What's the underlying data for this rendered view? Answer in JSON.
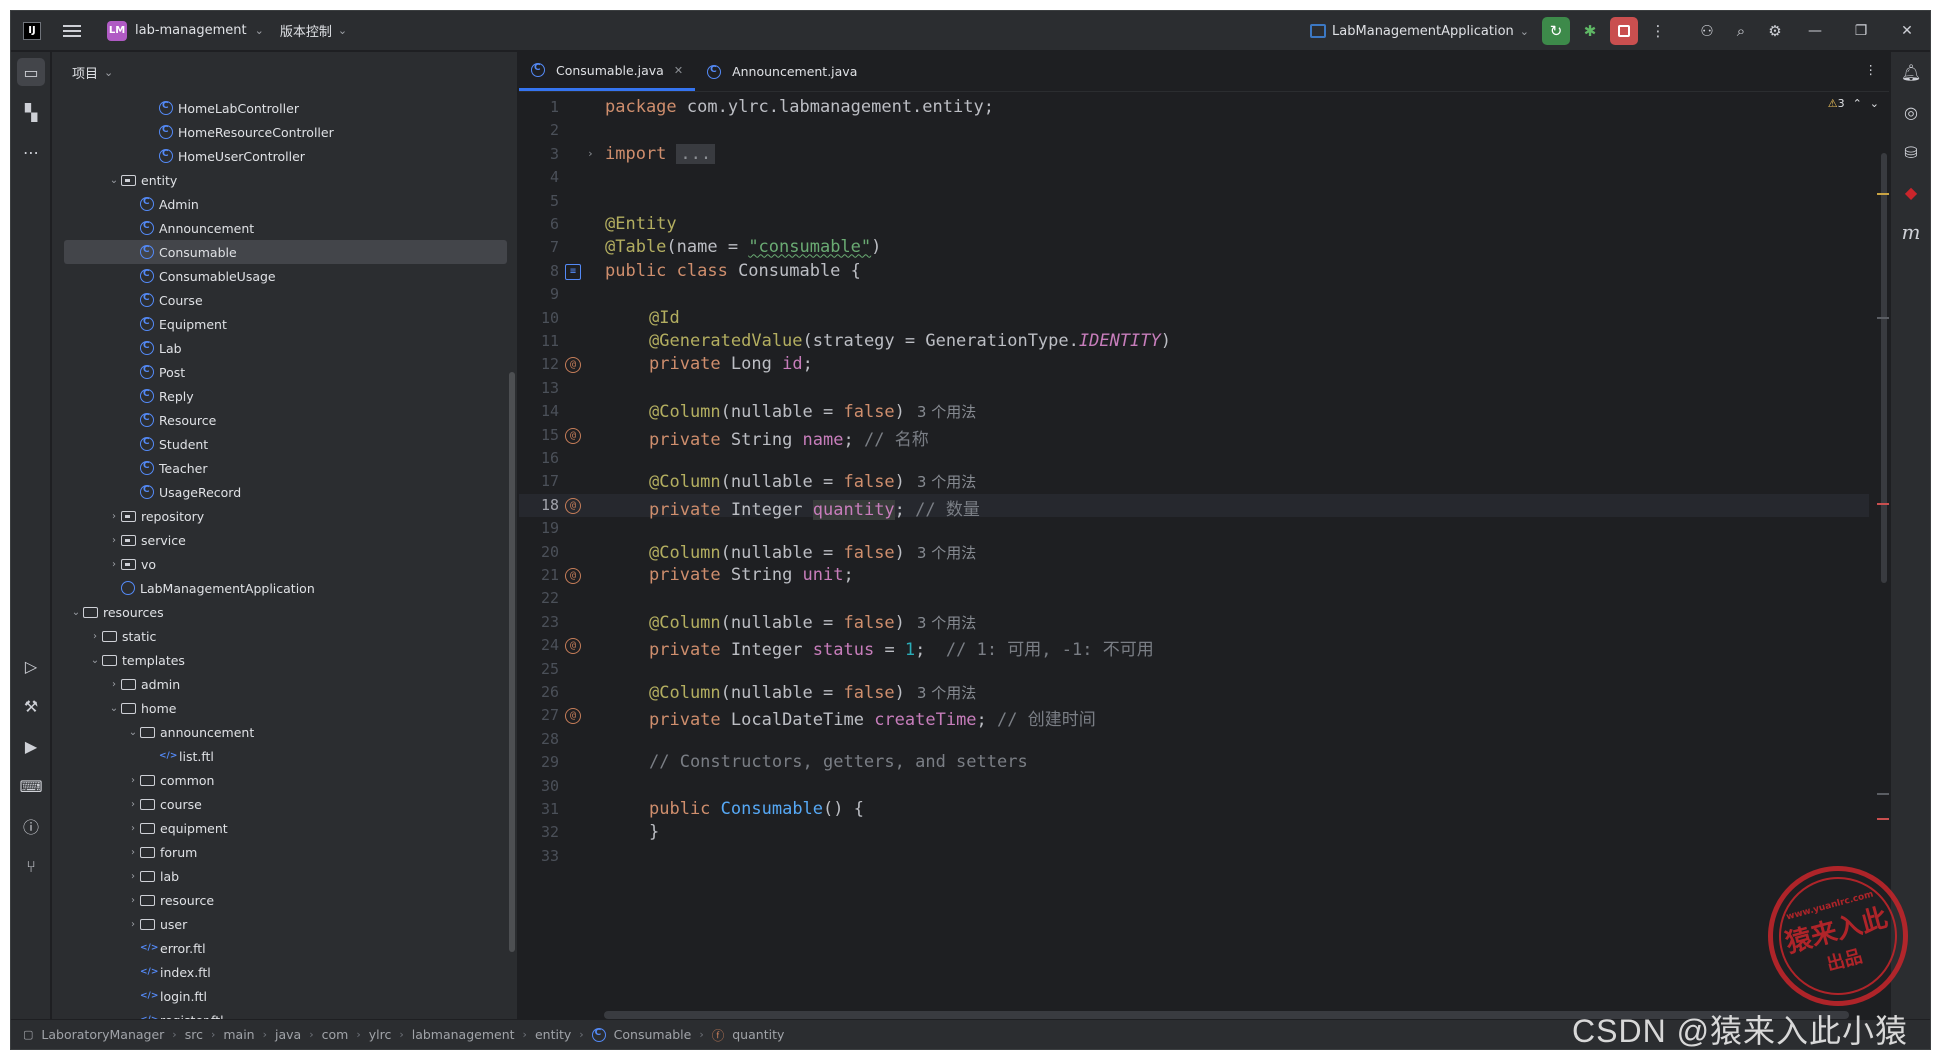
{
  "titlebar": {
    "logo": "IJ",
    "project_badge": "LM",
    "project_name": "lab-management",
    "vcs_label": "版本控制",
    "run_config": "LabManagementApplication"
  },
  "project_panel": {
    "title": "项目",
    "tree": [
      {
        "label": "HomeLabController",
        "indent": 7,
        "icon": "class",
        "arrow": ""
      },
      {
        "label": "HomeResourceController",
        "indent": 7,
        "icon": "class",
        "arrow": ""
      },
      {
        "label": "HomeUserController",
        "indent": 7,
        "icon": "class",
        "arrow": ""
      },
      {
        "label": "entity",
        "indent": 5,
        "icon": "package",
        "arrow": "open"
      },
      {
        "label": "Admin",
        "indent": 6,
        "icon": "class",
        "arrow": ""
      },
      {
        "label": "Announcement",
        "indent": 6,
        "icon": "class",
        "arrow": ""
      },
      {
        "label": "Consumable",
        "indent": 6,
        "icon": "class",
        "arrow": "",
        "selected": true
      },
      {
        "label": "ConsumableUsage",
        "indent": 6,
        "icon": "class",
        "arrow": ""
      },
      {
        "label": "Course",
        "indent": 6,
        "icon": "class",
        "arrow": ""
      },
      {
        "label": "Equipment",
        "indent": 6,
        "icon": "class",
        "arrow": ""
      },
      {
        "label": "Lab",
        "indent": 6,
        "icon": "class",
        "arrow": ""
      },
      {
        "label": "Post",
        "indent": 6,
        "icon": "class",
        "arrow": ""
      },
      {
        "label": "Reply",
        "indent": 6,
        "icon": "class",
        "arrow": ""
      },
      {
        "label": "Resource",
        "indent": 6,
        "icon": "class",
        "arrow": ""
      },
      {
        "label": "Student",
        "indent": 6,
        "icon": "class",
        "arrow": ""
      },
      {
        "label": "Teacher",
        "indent": 6,
        "icon": "class",
        "arrow": ""
      },
      {
        "label": "UsageRecord",
        "indent": 6,
        "icon": "class",
        "arrow": ""
      },
      {
        "label": "repository",
        "indent": 5,
        "icon": "package",
        "arrow": "closed"
      },
      {
        "label": "service",
        "indent": 5,
        "icon": "package",
        "arrow": "closed"
      },
      {
        "label": "vo",
        "indent": 5,
        "icon": "package",
        "arrow": "closed"
      },
      {
        "label": "LabManagementApplication",
        "indent": 5,
        "icon": "app",
        "arrow": ""
      },
      {
        "label": "resources",
        "indent": 3,
        "icon": "folder",
        "arrow": "open"
      },
      {
        "label": "static",
        "indent": 4,
        "icon": "folder",
        "arrow": "closed"
      },
      {
        "label": "templates",
        "indent": 4,
        "icon": "folder",
        "arrow": "open"
      },
      {
        "label": "admin",
        "indent": 5,
        "icon": "folder",
        "arrow": "closed"
      },
      {
        "label": "home",
        "indent": 5,
        "icon": "folder",
        "arrow": "open"
      },
      {
        "label": "announcement",
        "indent": 6,
        "icon": "folder",
        "arrow": "open"
      },
      {
        "label": "list.ftl",
        "indent": 7,
        "icon": "ftl",
        "arrow": ""
      },
      {
        "label": "common",
        "indent": 6,
        "icon": "folder",
        "arrow": "closed"
      },
      {
        "label": "course",
        "indent": 6,
        "icon": "folder",
        "arrow": "closed"
      },
      {
        "label": "equipment",
        "indent": 6,
        "icon": "folder",
        "arrow": "closed"
      },
      {
        "label": "forum",
        "indent": 6,
        "icon": "folder",
        "arrow": "closed"
      },
      {
        "label": "lab",
        "indent": 6,
        "icon": "folder",
        "arrow": "closed"
      },
      {
        "label": "resource",
        "indent": 6,
        "icon": "folder",
        "arrow": "closed"
      },
      {
        "label": "user",
        "indent": 6,
        "icon": "folder",
        "arrow": "closed"
      },
      {
        "label": "error.ftl",
        "indent": 6,
        "icon": "ftl",
        "arrow": ""
      },
      {
        "label": "index.ftl",
        "indent": 6,
        "icon": "ftl",
        "arrow": ""
      },
      {
        "label": "login.ftl",
        "indent": 6,
        "icon": "ftl",
        "arrow": ""
      },
      {
        "label": "register.ftl",
        "indent": 6,
        "icon": "ftl",
        "arrow": ""
      }
    ]
  },
  "editor": {
    "tabs": [
      {
        "label": "Consumable.java",
        "active": true
      },
      {
        "label": "Announcement.java",
        "active": false
      }
    ],
    "warnings_count": "3",
    "current_line": 18,
    "line_count": 33
  },
  "code": {
    "l1": [
      "package",
      " com.ylrc.labmanagement.entity;"
    ],
    "l3": [
      "import",
      "..."
    ],
    "l6": "@Entity",
    "l7": [
      "@Table",
      "(name = ",
      "\"consumable\"",
      ")"
    ],
    "l8": [
      "public class",
      " Consumable {"
    ],
    "l10": "@Id",
    "l11": [
      "@GeneratedValue",
      "(strategy = GenerationType.",
      "IDENTITY",
      ")"
    ],
    "l12": [
      "private",
      " Long ",
      "id",
      ";"
    ],
    "column": [
      "@Column",
      "(nullable = ",
      "false",
      ")"
    ],
    "usage_hint": "3 个用法",
    "l15": [
      "private",
      " String ",
      "name",
      "; ",
      "// 名称"
    ],
    "l18": [
      "private",
      " Integer ",
      "quantity",
      "; ",
      "// 数量"
    ],
    "l21": [
      "private",
      " String ",
      "unit",
      ";"
    ],
    "l24": [
      "private",
      " Integer ",
      "status",
      " = ",
      "1",
      ";  ",
      "// 1: 可用, -1: 不可用"
    ],
    "l27": [
      "private",
      " LocalDateTime ",
      "createTime",
      "; ",
      "// 创建时间"
    ],
    "l29": "// Constructors, getters, and setters",
    "l31": [
      "public",
      " ",
      "Consumable",
      "() {"
    ],
    "l32": "}"
  },
  "breadcrumb": [
    "LaboratoryManager",
    "src",
    "main",
    "java",
    "com",
    "ylrc",
    "labmanagement",
    "entity",
    "Consumable",
    "quantity"
  ],
  "watermark": {
    "stamp_url": "www.yuanlrc.com",
    "stamp_main": "猿来入此",
    "stamp_sub": "出品",
    "csdn": "CSDN @猿来入此小猿"
  },
  "colors": {
    "accent": "#3574f0",
    "keyword": "#cf8e6d",
    "annotation": "#b3ae60",
    "string": "#6aab73",
    "field": "#c77dbb",
    "number": "#2aacb8"
  }
}
